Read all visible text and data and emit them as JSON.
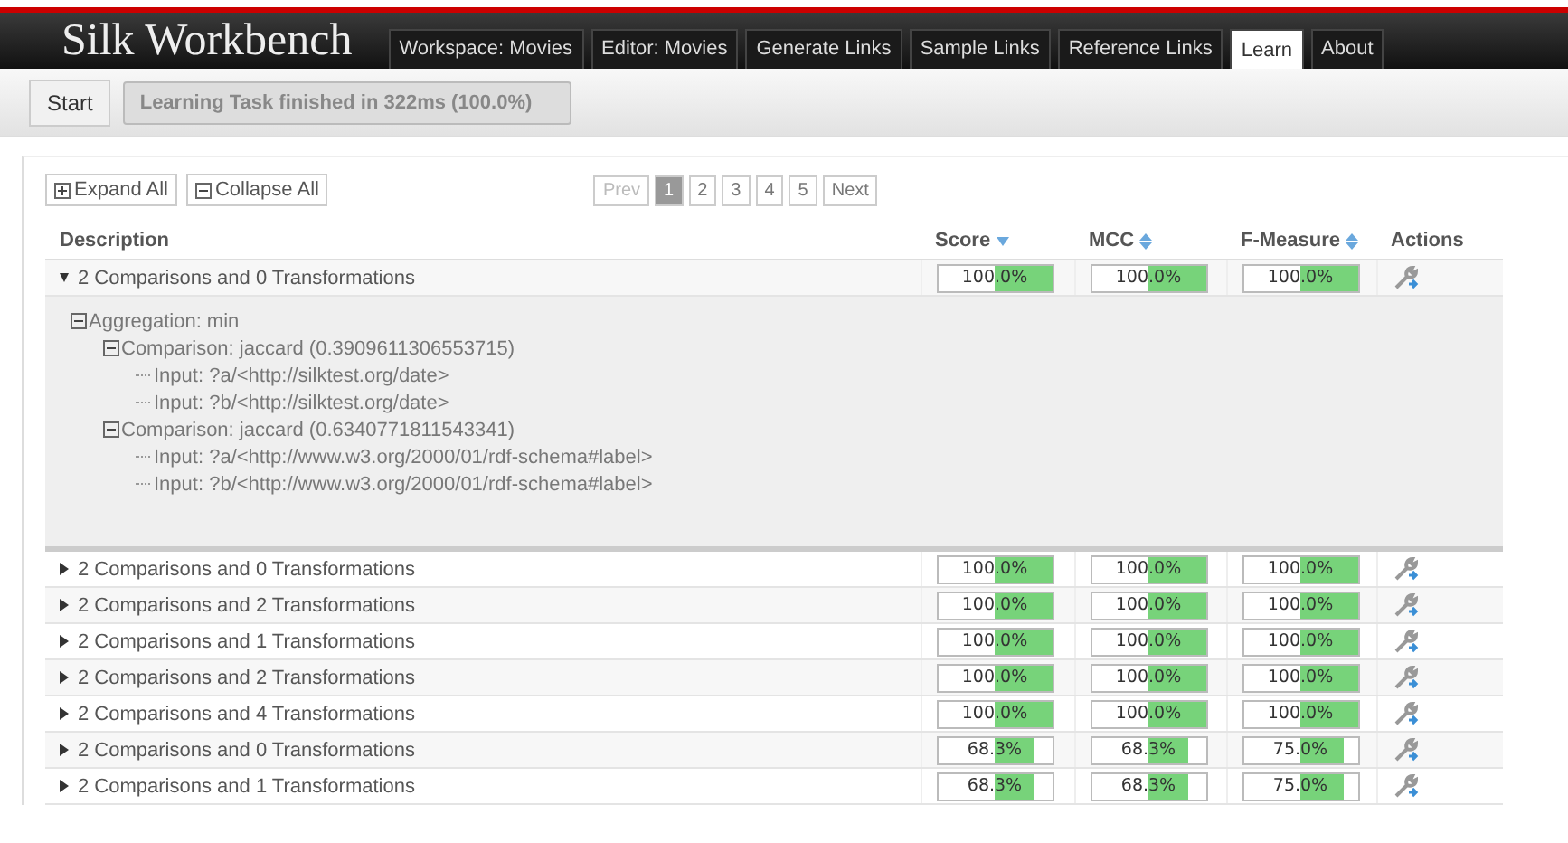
{
  "app_title": "Silk Workbench",
  "tabs": [
    {
      "label": "Workspace: Movies",
      "selected": false
    },
    {
      "label": "Editor: Movies",
      "selected": false
    },
    {
      "label": "Generate Links",
      "selected": false
    },
    {
      "label": "Sample Links",
      "selected": false
    },
    {
      "label": "Reference Links",
      "selected": false
    },
    {
      "label": "Learn",
      "selected": true
    },
    {
      "label": "About",
      "selected": false
    }
  ],
  "toolbar": {
    "start_button": "Start",
    "status": "Learning Task finished in 322ms (100.0%)"
  },
  "tree_buttons": [
    "Expand All",
    "Collapse All"
  ],
  "pagination": {
    "prev": "Prev",
    "next": "Next",
    "pages": [
      {
        "label": "1",
        "selected": true
      },
      {
        "label": "2",
        "selected": false
      },
      {
        "label": "3",
        "selected": false
      },
      {
        "label": "4",
        "selected": false
      },
      {
        "label": "5",
        "selected": false
      }
    ]
  },
  "table": {
    "columns": [
      {
        "label": "Description"
      },
      {
        "label": "Score",
        "sorted": true
      },
      {
        "label": "MCC",
        "sorted": false
      },
      {
        "label": "F-Measure",
        "sorted": false
      },
      {
        "label": "Actions"
      }
    ],
    "rows": [
      {
        "description": "2 Comparisons and 0 Transformations",
        "expanded": true,
        "score": {
          "text": "100.0%",
          "level": 1
        },
        "mcc": {
          "text": "100.0%",
          "level": 1
        },
        "f_measure": {
          "text": "100.0%",
          "level": 1
        },
        "detail": [
          {
            "label": "Aggregation: min",
            "children": [
              {
                "label": "Comparison: jaccard (0.3909611306553715)",
                "children": [
                  {
                    "label": "Input: ?a/<http://silktest.org/date>"
                  },
                  {
                    "label": "Input: ?b/<http://silktest.org/date>"
                  }
                ]
              },
              {
                "label": "Comparison: jaccard (0.6340771811543341)",
                "children": [
                  {
                    "label": "Input: ?a/<http://www.w3.org/2000/01/rdf-schema#label>"
                  },
                  {
                    "label": "Input: ?b/<http://www.w3.org/2000/01/rdf-schema#label>"
                  }
                ]
              }
            ]
          }
        ]
      },
      {
        "description": "2 Comparisons and 0 Transformations",
        "expanded": false,
        "score": {
          "text": "100.0%",
          "level": 1
        },
        "mcc": {
          "text": "100.0%",
          "level": 1
        },
        "f_measure": {
          "text": "100.0%",
          "level": 1
        }
      },
      {
        "description": "2 Comparisons and 2 Transformations",
        "expanded": false,
        "score": {
          "text": "100.0%",
          "level": 1
        },
        "mcc": {
          "text": "100.0%",
          "level": 1
        },
        "f_measure": {
          "text": "100.0%",
          "level": 1
        }
      },
      {
        "description": "2 Comparisons and 1 Transformations",
        "expanded": false,
        "score": {
          "text": "100.0%",
          "level": 1
        },
        "mcc": {
          "text": "100.0%",
          "level": 1
        },
        "f_measure": {
          "text": "100.0%",
          "level": 1
        }
      },
      {
        "description": "2 Comparisons and 2 Transformations",
        "expanded": false,
        "score": {
          "text": "100.0%",
          "level": 1
        },
        "mcc": {
          "text": "100.0%",
          "level": 1
        },
        "f_measure": {
          "text": "100.0%",
          "level": 1
        }
      },
      {
        "description": "2 Comparisons and 4 Transformations",
        "expanded": false,
        "score": {
          "text": "100.0%",
          "level": 1
        },
        "mcc": {
          "text": "100.0%",
          "level": 1
        },
        "f_measure": {
          "text": "100.0%",
          "level": 1
        }
      },
      {
        "description": "2 Comparisons and 0 Transformations",
        "expanded": false,
        "score": {
          "text": "68.3%",
          "level": 0.683
        },
        "mcc": {
          "text": "68.3%",
          "level": 0.683
        },
        "f_measure": {
          "text": "75.0%",
          "level": 0.75
        }
      },
      {
        "description": "2 Comparisons and 1 Transformations",
        "expanded": false,
        "score": {
          "text": "68.3%",
          "level": 0.683
        },
        "mcc": {
          "text": "68.3%",
          "level": 0.683
        },
        "f_measure": {
          "text": "75.0%",
          "level": 0.75
        }
      }
    ]
  }
}
